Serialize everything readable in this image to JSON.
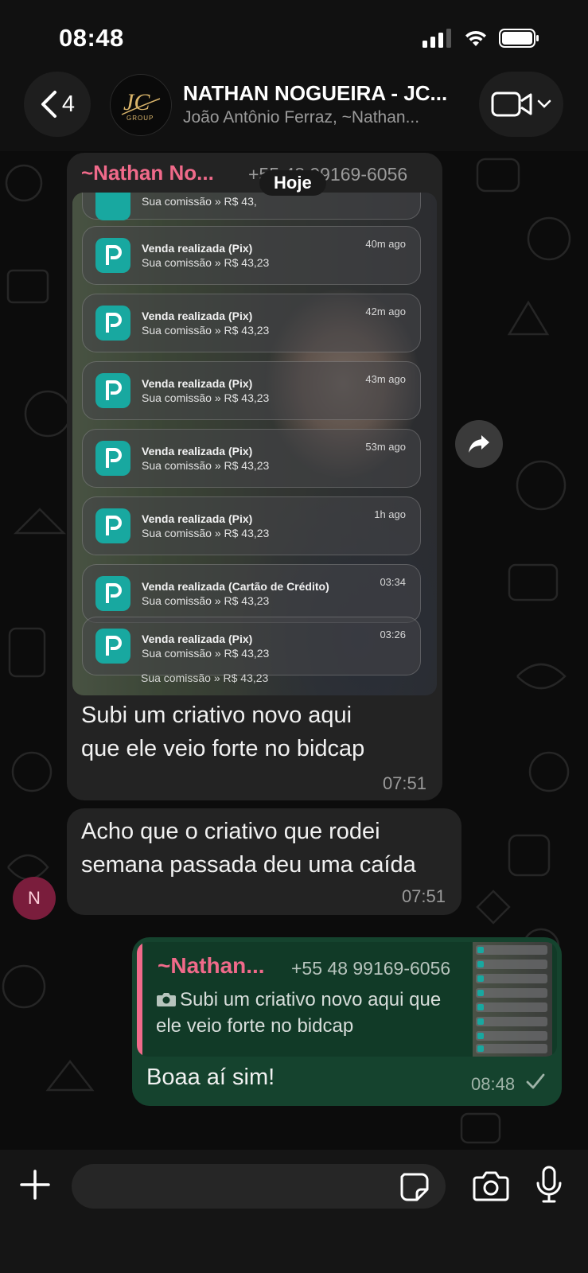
{
  "status_bar": {
    "time": "08:48"
  },
  "header": {
    "back_count": "4",
    "title": "NATHAN NOGUEIRA - JC...",
    "subtitle": "João Antônio Ferraz, ~Nathan..."
  },
  "chat": {
    "date_chip": "Hoje",
    "msg1": {
      "sender": "~Nathan No...",
      "phone": "+55 48 99169-6056",
      "screenshot_notifications": [
        {
          "title": "Venda realizada (Pix)",
          "text": "Sua comissão » R$ 43,23",
          "time": "40m ago"
        },
        {
          "title": "Venda realizada (Pix)",
          "text": "Sua comissão » R$ 43,23",
          "time": "42m ago"
        },
        {
          "title": "Venda realizada (Pix)",
          "text": "Sua comissão » R$ 43,23",
          "time": "43m ago"
        },
        {
          "title": "Venda realizada (Pix)",
          "text": "Sua comissão » R$ 43,23",
          "time": "53m ago"
        },
        {
          "title": "Venda realizada (Pix)",
          "text": "Sua comissão » R$ 43,23",
          "time": "1h ago"
        },
        {
          "title": "Venda realizada (Cartão de Crédito)",
          "text": "Sua comissão » R$ 43,23",
          "time": "03:34"
        },
        {
          "title": "Venda realizada (Pix)",
          "text": "Sua comissão » R$ 43,23",
          "time": "03:26"
        }
      ],
      "partial_top_text": "Sua comissão » R$ 43,",
      "partial_bottom_text": "Sua comissão » R$ 43,23",
      "text_line1": "Subi um criativo novo aqui",
      "text_line2": "que ele veio forte no bidcap",
      "time": "07:51"
    },
    "msg2": {
      "text_line1": "Acho que o criativo que rodei",
      "text_line2": "semana passada deu uma caída",
      "time": "07:51",
      "avatar_initial": "N"
    },
    "msg3": {
      "quote_sender": "~Nathan...",
      "quote_phone": "+55 48 99169-6056",
      "quote_text": "Subi um criativo novo aqui que ele veio forte no bidcap",
      "text": "Boaa aí sim!",
      "time": "08:48"
    }
  },
  "input_bar": {
    "placeholder": ""
  },
  "colors": {
    "sender_accent": "#f06a8a",
    "outgoing_bubble": "#15432e",
    "incoming_bubble": "#232323",
    "app_icon": "#18a8a0"
  }
}
